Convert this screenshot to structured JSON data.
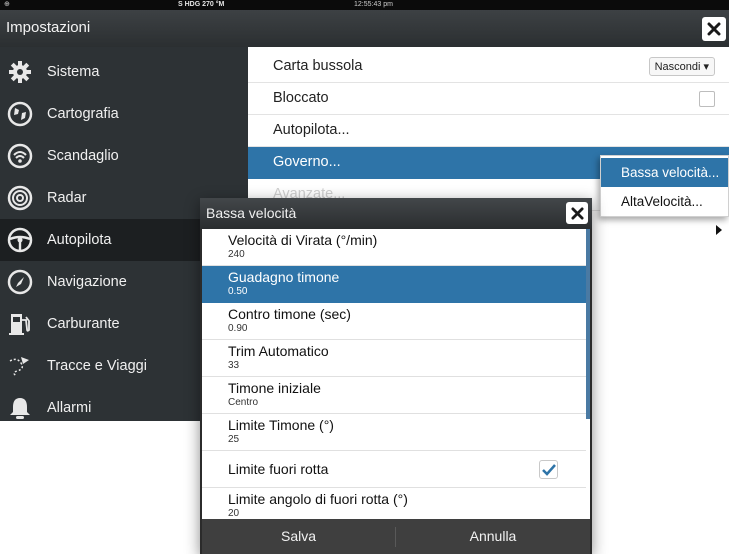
{
  "status_bar": {
    "left_icon": "gps-icon",
    "heading": "S HDG 270 °M",
    "time": "12:55:43 pm"
  },
  "window": {
    "title": "Impostazioni",
    "close_icon": "close-icon"
  },
  "sidebar": {
    "items": [
      {
        "label": "Sistema",
        "icon": "gear-icon"
      },
      {
        "label": "Cartografia",
        "icon": "chart-globe-icon"
      },
      {
        "label": "Scandaglio",
        "icon": "sonar-icon"
      },
      {
        "label": "Radar",
        "icon": "radar-icon"
      },
      {
        "label": "Autopilota",
        "icon": "steering-wheel-icon",
        "selected": true
      },
      {
        "label": "Navigazione",
        "icon": "compass-icon"
      },
      {
        "label": "Carburante",
        "icon": "fuel-pump-icon"
      },
      {
        "label": "Tracce e Viaggi",
        "icon": "track-icon"
      },
      {
        "label": "Allarmi",
        "icon": "bell-icon"
      }
    ]
  },
  "main": {
    "rows": [
      {
        "label": "Carta bussola",
        "control": "Nascondi ▾"
      },
      {
        "label": "Bloccato"
      },
      {
        "label": "Autopilota..."
      },
      {
        "label": "Governo..."
      },
      {
        "label": "Avanzate..."
      }
    ]
  },
  "submenu": {
    "items": [
      "Bassa velocità...",
      "AltaVelocità..."
    ]
  },
  "dialog": {
    "title": "Bassa velocità",
    "items": [
      {
        "name": "Velocità di Virata (°/min)",
        "value": "240"
      },
      {
        "name": "Guadagno timone",
        "value": "0.50"
      },
      {
        "name": "Contro timone (sec)",
        "value": "0.90"
      },
      {
        "name": "Trim Automatico",
        "value": "33"
      },
      {
        "name": "Timone iniziale",
        "value": "Centro"
      },
      {
        "name": "Limite Timone (°)",
        "value": "25"
      },
      {
        "name": "Limite fuori rotta",
        "value": ""
      },
      {
        "name": "Limite angolo di fuori rotta (°)",
        "value": "20"
      }
    ],
    "save_label": "Salva",
    "cancel_label": "Annulla"
  },
  "colors": {
    "highlight": "#2e74a8",
    "sidebar_bg": "#2d3235",
    "dialog_frame": "#2b2b2b"
  }
}
